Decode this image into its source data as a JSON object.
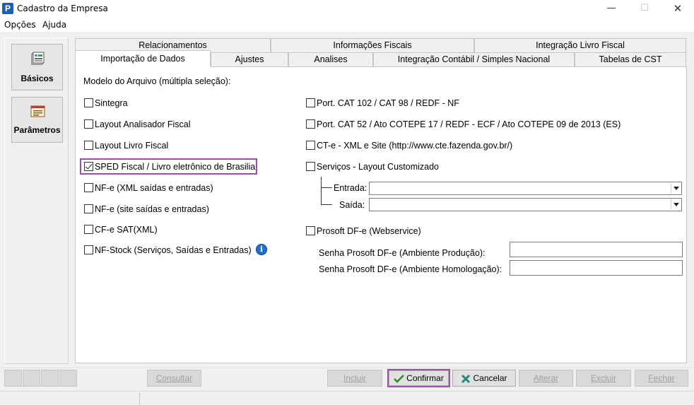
{
  "window": {
    "title": "Cadastro da Empresa",
    "app_icon_letter": "P",
    "min_glyph": "—",
    "max_glyph": "☐",
    "close_glyph": "✕"
  },
  "menu": {
    "opcoes": "Opções",
    "ajuda": "Ajuda"
  },
  "sidebar": {
    "items": [
      {
        "label": "Básicos",
        "icon": "basics-icon",
        "selected": true
      },
      {
        "label": "Parâmetros",
        "icon": "parameters-icon",
        "selected": false
      }
    ]
  },
  "tabs": {
    "row1": [
      "Relacionamentos",
      "Informações Fiscais",
      "Integração Livro Fiscal"
    ],
    "row2": [
      "Importação de Dados",
      "Ajustes",
      "Analises",
      "Integração Contábil / Simples Nacional",
      "Tabelas de CST"
    ],
    "active": "Importação de Dados"
  },
  "panel": {
    "section_label": "Modelo do Arquivo (múltipla seleção):",
    "left_options": [
      {
        "label": "Sintegra",
        "checked": false
      },
      {
        "label": "Layout Analisador Fiscal",
        "checked": false
      },
      {
        "label": "Layout Livro Fiscal",
        "checked": false
      },
      {
        "label": "SPED Fiscal / Livro eletrônico de Brasilia",
        "checked": true
      },
      {
        "label": "NF-e (XML saídas e entradas)",
        "checked": false
      },
      {
        "label": "NF-e (site saídas e entradas)",
        "checked": false
      },
      {
        "label": "CF-e SAT(XML)",
        "checked": false
      },
      {
        "label": "NF-Stock (Serviços, Saídas e Entradas)",
        "checked": false
      }
    ],
    "info_glyph": "i",
    "right_options": [
      {
        "label": "Port. CAT 102 / CAT 98 / REDF - NF",
        "checked": false
      },
      {
        "label": "Port. CAT 52 / Ato COTEPE 17 / REDF - ECF / Ato COTEPE 09 de 2013 (ES)",
        "checked": false
      },
      {
        "label": "CT-e - XML e Site (http://www.cte.fazenda.gov.br/)",
        "checked": false
      },
      {
        "label": "Serviços - Layout Customizado",
        "checked": false
      }
    ],
    "entrada_label": "Entrada:",
    "entrada_value": "",
    "saida_label": "Saída:",
    "saida_value": "",
    "prosoft_label": "Prosoft DF-e (Webservice)",
    "prosoft_checked": false,
    "senha_producao_label": "Senha Prosoft DF-e (Ambiente Produção):",
    "senha_producao_value": "",
    "senha_homologacao_label": "Senha Prosoft DF-e (Ambiente Homologação):",
    "senha_homologacao_value": ""
  },
  "toolbar": {
    "consultar": "Consultar",
    "incluir": "Incluir",
    "confirmar": "Confirmar",
    "cancelar": "Cancelar",
    "alterar": "Alterar",
    "excluir": "Excluir",
    "fechar": "Fechar"
  },
  "colors": {
    "highlight": "#a04ea8",
    "info_blue": "#1d6fd0",
    "confirm_green": "#2f8a2f",
    "cancel_teal": "#2a8a7a"
  }
}
